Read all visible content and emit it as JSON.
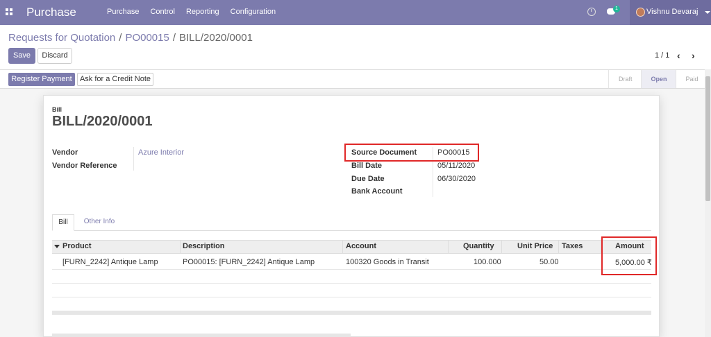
{
  "app": {
    "brand": "Purchase"
  },
  "nav": {
    "menu": [
      "Purchase",
      "Control",
      "Reporting",
      "Configuration"
    ],
    "message_count": "1",
    "user_name": "Vishnu Devaraj"
  },
  "breadcrumb": {
    "items": [
      "Requests for Quotation",
      "PO00015"
    ],
    "current": "BILL/2020/0001"
  },
  "actions": {
    "save_label": "Save",
    "discard_label": "Discard"
  },
  "pager": {
    "value": "1 / 1"
  },
  "statusbar": {
    "register_payment": "Register Payment",
    "credit_note": "Ask for a Credit Note",
    "stages": [
      "Draft",
      "Open",
      "Paid"
    ],
    "active_stage": "Open"
  },
  "bill": {
    "type_label": "Bill",
    "title": "BILL/2020/0001",
    "vendor_label": "Vendor",
    "vendor": "Azure Interior",
    "vendor_reference_label": "Vendor Reference",
    "source_document_label": "Source Document",
    "source_document": "PO00015",
    "bill_date_label": "Bill Date",
    "bill_date": "05/11/2020",
    "due_date_label": "Due Date",
    "due_date": "06/30/2020",
    "bank_account_label": "Bank Account"
  },
  "tabs": [
    "Bill",
    "Other Info"
  ],
  "table": {
    "columns": [
      "Product",
      "Description",
      "Account",
      "Quantity",
      "Unit Price",
      "Taxes",
      "Amount"
    ],
    "rows": [
      [
        "[FURN_2242] Antique Lamp",
        "PO00015: [FURN_2242] Antique Lamp",
        "100320 Goods in Transit",
        "100.000",
        "50.00",
        "",
        "5,000.00 ₹"
      ]
    ]
  },
  "colors": {
    "brand": "#7c7bad",
    "highlight": "#e02828"
  }
}
